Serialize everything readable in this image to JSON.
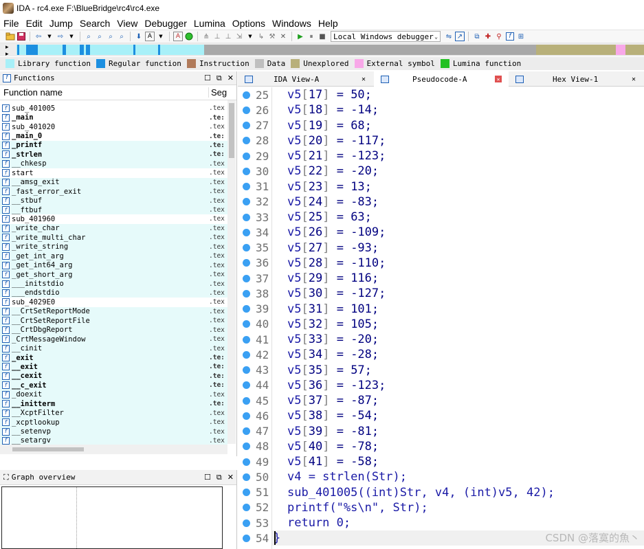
{
  "window": {
    "title": "IDA - rc4.exe F:\\BlueBridge\\rc4\\rc4.exe"
  },
  "menu": [
    "File",
    "Edit",
    "Jump",
    "Search",
    "View",
    "Debugger",
    "Lumina",
    "Options",
    "Windows",
    "Help"
  ],
  "toolbar": {
    "debugger_select": "Local Windows debugger"
  },
  "legend": [
    {
      "label": "Library function",
      "color": "#a8f0f8"
    },
    {
      "label": "Regular function",
      "color": "#1c8fe0"
    },
    {
      "label": "Instruction",
      "color": "#b07a5a"
    },
    {
      "label": "Data",
      "color": "#bfbfbf"
    },
    {
      "label": "Unexplored",
      "color": "#b8b07a"
    },
    {
      "label": "External symbol",
      "color": "#f8a8e8"
    },
    {
      "label": "Lumina function",
      "color": "#22c022"
    }
  ],
  "functions_panel": {
    "title": "Functions",
    "col_name": "Function name",
    "col_seg": "Seg",
    "rows": [
      {
        "name": "sub_401005",
        "seg": ".tex",
        "bold": false,
        "lib": false
      },
      {
        "name": "_main",
        "seg": ".te:",
        "bold": true,
        "lib": false
      },
      {
        "name": "sub_401020",
        "seg": ".tex",
        "bold": false,
        "lib": false
      },
      {
        "name": "_main_0",
        "seg": ".te:",
        "bold": true,
        "lib": false
      },
      {
        "name": "_printf",
        "seg": ".te:",
        "bold": true,
        "lib": true
      },
      {
        "name": "_strlen",
        "seg": ".te:",
        "bold": true,
        "lib": true
      },
      {
        "name": "__chkesp",
        "seg": ".tex",
        "bold": false,
        "lib": true
      },
      {
        "name": "start",
        "seg": ".tex",
        "bold": false,
        "lib": false
      },
      {
        "name": "__amsg_exit",
        "seg": ".tex",
        "bold": false,
        "lib": true
      },
      {
        "name": "_fast_error_exit",
        "seg": ".tex",
        "bold": false,
        "lib": true
      },
      {
        "name": "__stbuf",
        "seg": ".tex",
        "bold": false,
        "lib": true
      },
      {
        "name": "__ftbuf",
        "seg": ".tex",
        "bold": false,
        "lib": true
      },
      {
        "name": "sub_401960",
        "seg": ".tex",
        "bold": false,
        "lib": false
      },
      {
        "name": "_write_char",
        "seg": ".tex",
        "bold": false,
        "lib": true
      },
      {
        "name": "_write_multi_char",
        "seg": ".tex",
        "bold": false,
        "lib": true
      },
      {
        "name": "_write_string",
        "seg": ".tex",
        "bold": false,
        "lib": true
      },
      {
        "name": "_get_int_arg",
        "seg": ".tex",
        "bold": false,
        "lib": true
      },
      {
        "name": "_get_int64_arg",
        "seg": ".tex",
        "bold": false,
        "lib": true
      },
      {
        "name": "_get_short_arg",
        "seg": ".tex",
        "bold": false,
        "lib": true
      },
      {
        "name": "___initstdio",
        "seg": ".tex",
        "bold": false,
        "lib": true
      },
      {
        "name": "___endstdio",
        "seg": ".tex",
        "bold": false,
        "lib": true
      },
      {
        "name": "sub_4029E0",
        "seg": ".tex",
        "bold": false,
        "lib": false
      },
      {
        "name": "__CrtSetReportMode",
        "seg": ".tex",
        "bold": false,
        "lib": true
      },
      {
        "name": "__CrtSetReportFile",
        "seg": ".tex",
        "bold": false,
        "lib": true
      },
      {
        "name": "__CrtDbgReport",
        "seg": ".tex",
        "bold": false,
        "lib": true
      },
      {
        "name": "_CrtMessageWindow",
        "seg": ".tex",
        "bold": false,
        "lib": true
      },
      {
        "name": "__cinit",
        "seg": ".tex",
        "bold": false,
        "lib": true
      },
      {
        "name": "_exit",
        "seg": ".te:",
        "bold": true,
        "lib": true
      },
      {
        "name": "__exit",
        "seg": ".te:",
        "bold": true,
        "lib": true
      },
      {
        "name": "__cexit",
        "seg": ".te:",
        "bold": true,
        "lib": true
      },
      {
        "name": "__c_exit",
        "seg": ".te:",
        "bold": true,
        "lib": true
      },
      {
        "name": "_doexit",
        "seg": ".tex",
        "bold": false,
        "lib": true
      },
      {
        "name": "__initterm",
        "seg": ".te:",
        "bold": true,
        "lib": true
      },
      {
        "name": "__XcptFilter",
        "seg": ".tex",
        "bold": false,
        "lib": true
      },
      {
        "name": "_xcptlookup",
        "seg": ".tex",
        "bold": false,
        "lib": true
      },
      {
        "name": "__setenvp",
        "seg": ".tex",
        "bold": false,
        "lib": true
      },
      {
        "name": "__setargv",
        "seg": ".tex",
        "bold": false,
        "lib": true
      }
    ]
  },
  "graph_overview": {
    "title": "Graph overview"
  },
  "tabs": [
    {
      "label": "IDA View-A",
      "active": false
    },
    {
      "label": "Pseudocode-A",
      "active": true
    },
    {
      "label": "Hex View-1",
      "active": false
    }
  ],
  "code_lines": [
    {
      "n": "25",
      "idx": "17",
      "val": "50"
    },
    {
      "n": "26",
      "idx": "18",
      "val": "-14"
    },
    {
      "n": "27",
      "idx": "19",
      "val": "68"
    },
    {
      "n": "28",
      "idx": "20",
      "val": "-117"
    },
    {
      "n": "29",
      "idx": "21",
      "val": "-123"
    },
    {
      "n": "30",
      "idx": "22",
      "val": "-20"
    },
    {
      "n": "31",
      "idx": "23",
      "val": "13"
    },
    {
      "n": "32",
      "idx": "24",
      "val": "-83"
    },
    {
      "n": "33",
      "idx": "25",
      "val": "63"
    },
    {
      "n": "34",
      "idx": "26",
      "val": "-109"
    },
    {
      "n": "35",
      "idx": "27",
      "val": "-93"
    },
    {
      "n": "36",
      "idx": "28",
      "val": "-110"
    },
    {
      "n": "37",
      "idx": "29",
      "val": "116"
    },
    {
      "n": "38",
      "idx": "30",
      "val": "-127"
    },
    {
      "n": "39",
      "idx": "31",
      "val": "101"
    },
    {
      "n": "40",
      "idx": "32",
      "val": "105"
    },
    {
      "n": "41",
      "idx": "33",
      "val": "-20"
    },
    {
      "n": "42",
      "idx": "34",
      "val": "-28"
    },
    {
      "n": "43",
      "idx": "35",
      "val": "57"
    },
    {
      "n": "44",
      "idx": "36",
      "val": "-123"
    },
    {
      "n": "45",
      "idx": "37",
      "val": "-87"
    },
    {
      "n": "46",
      "idx": "38",
      "val": "-54"
    },
    {
      "n": "47",
      "idx": "39",
      "val": "-81"
    },
    {
      "n": "48",
      "idx": "40",
      "val": "-78"
    },
    {
      "n": "49",
      "idx": "41",
      "val": "-58"
    }
  ],
  "code_tail": [
    {
      "n": "50",
      "text": "v4 = strlen(Str);"
    },
    {
      "n": "51",
      "text": "sub_401005((int)Str, v4, (int)v5, 42);"
    },
    {
      "n": "52",
      "text": "printf(\"%s\\n\", Str);"
    },
    {
      "n": "53",
      "text": "return 0;"
    },
    {
      "n": "54",
      "text": "}"
    }
  ],
  "watermark": "CSDN @落寞的魚丶"
}
